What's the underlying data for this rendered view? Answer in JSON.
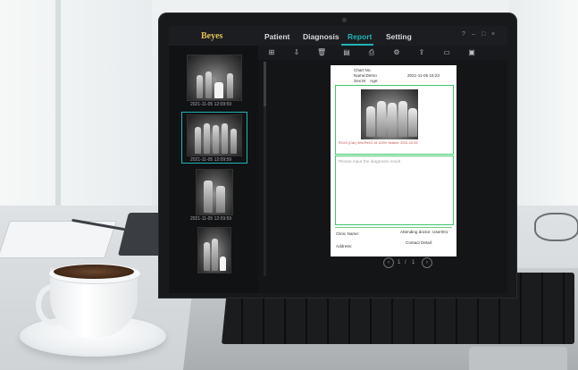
{
  "app": {
    "logo": "Beyes",
    "tabs": [
      {
        "label": "Patient",
        "active": false
      },
      {
        "label": "Diagnosis",
        "active": false
      },
      {
        "label": "Report",
        "active": true
      },
      {
        "label": "Setting",
        "active": false
      }
    ],
    "window_controls": [
      "?",
      "–",
      "□",
      "×"
    ],
    "accent_color": "#1fb5b7"
  },
  "toolbar": {
    "icons": [
      "add-page-icon",
      "import-icon",
      "delete-icon",
      "document-icon",
      "print-icon",
      "gear-icon",
      "export-icon",
      "folder-icon",
      "save-icon"
    ]
  },
  "sidebar": {
    "thumbnails": [
      {
        "date": "2021-11-05 12:09:59",
        "selected": false
      },
      {
        "date": "2021-11-05 12:09:59",
        "selected": true
      },
      {
        "date": "2021-11-05 12:09:59",
        "selected": false
      },
      {
        "date": "",
        "selected": false
      }
    ]
  },
  "report": {
    "chart_no_label": "Chart No.",
    "name_label": "Name:Demo",
    "sex_label": "Sex:M",
    "age_label": "Age:",
    "datetime": "2021-11-05 15:23",
    "image_caption": "ROI:0  (Cal.)  Win:Ref:2.19    123% Search: 2021-12.09",
    "diagnosis_placeholder": "Please input the diagnosis result",
    "clinic_name_label": "Clinic Name:",
    "attending_doctor": "Attending doctor: User001",
    "address_label": "Address:",
    "contact_label": "Contact Detail:"
  },
  "pager": {
    "current": "1",
    "separator": "/",
    "total": "1",
    "prev_icon": "chevron-left-icon",
    "next_icon": "chevron-right-icon"
  }
}
